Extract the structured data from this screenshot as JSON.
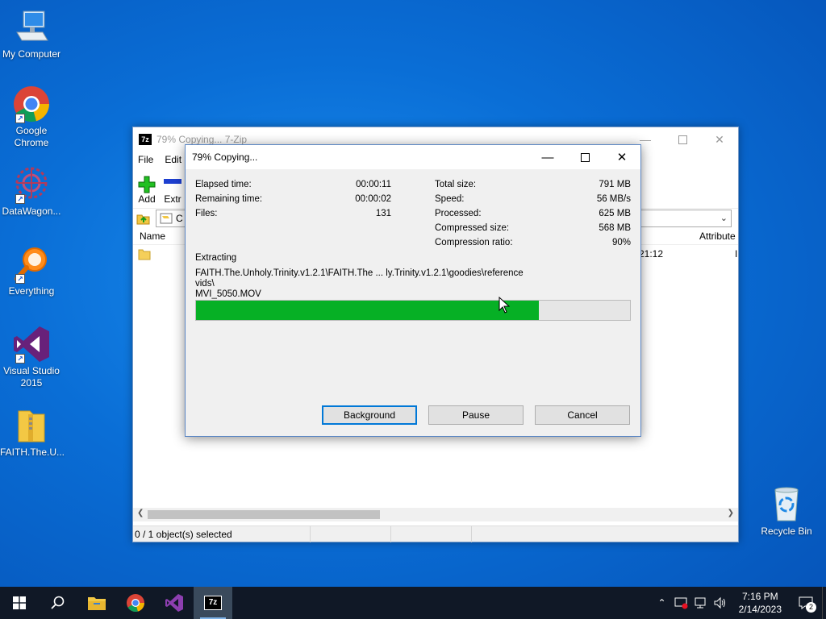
{
  "desktop": {
    "icons": [
      {
        "label": "My Computer"
      },
      {
        "label": "Google Chrome"
      },
      {
        "label": "DataWagon..."
      },
      {
        "label": "Everything"
      },
      {
        "label": "Visual Studio 2015"
      },
      {
        "label": "FAITH.The.U..."
      },
      {
        "label": "Recycle Bin"
      }
    ]
  },
  "main_window": {
    "app_icon": "7z",
    "title": "79% Copying... 7-Zip",
    "menu": [
      "File",
      "Edit"
    ],
    "toolbar": [
      {
        "label": "Add",
        "icon": "plus-icon"
      },
      {
        "label": "Extr",
        "icon": "minus-icon"
      }
    ],
    "address_value": "C",
    "columns": {
      "name": "Name",
      "attributes": "Attribute"
    },
    "row": {
      "time_fragment": "21:12",
      "attr_fragment": "I"
    },
    "status": "0 / 1 object(s) selected"
  },
  "dialog": {
    "title": "79% Copying...",
    "left_stats": [
      {
        "label": "Elapsed time:",
        "value": "00:00:11"
      },
      {
        "label": "Remaining time:",
        "value": "00:00:02"
      },
      {
        "label": "Files:",
        "value": "131"
      }
    ],
    "right_stats": [
      {
        "label": "Total size:",
        "value": "791 MB"
      },
      {
        "label": "Speed:",
        "value": "56 MB/s"
      },
      {
        "label": "Processed:",
        "value": "625 MB"
      },
      {
        "label": "Compressed size:",
        "value": "568 MB"
      },
      {
        "label": "Compression ratio:",
        "value": "90%"
      }
    ],
    "operation": "Extracting",
    "path_line1": "FAITH.The.Unholy.Trinity.v1.2.1\\FAITH.The ... ly.Trinity.v1.2.1\\goodies\\reference vids\\",
    "path_line2": "MVI_5050.MOV",
    "progress_percent": 79,
    "buttons": {
      "background": "Background",
      "pause": "Pause",
      "cancel": "Cancel"
    }
  },
  "taskbar": {
    "apps": [
      "start-icon",
      "search-icon",
      "file-explorer-icon",
      "chrome-icon",
      "visual-studio-icon",
      "7zip-icon"
    ],
    "clock_time": "7:16 PM",
    "clock_date": "2/14/2023",
    "notification_count": "2",
    "colors": {
      "taskbar": "#101826",
      "progress": "#06b025",
      "accent": "#0078d7"
    }
  }
}
